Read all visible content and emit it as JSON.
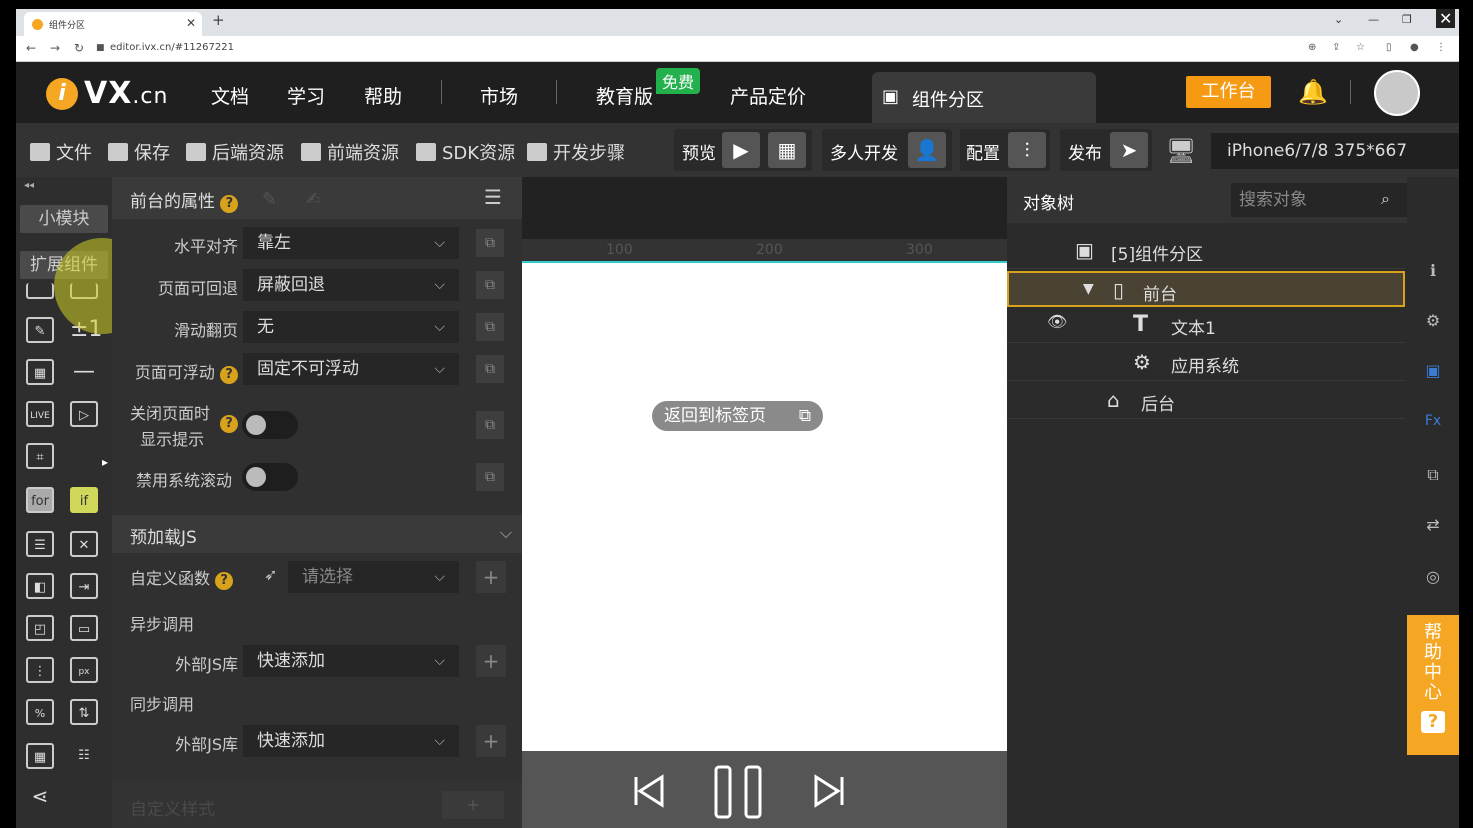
{
  "browser": {
    "tab_title": "组件分区",
    "url": "editor.ivx.cn/#11267221"
  },
  "header": {
    "logo_text": "VX",
    "logo_suffix": ".cn",
    "nav": [
      "文档",
      "学习",
      "帮助",
      "市场",
      "教育版",
      "产品定价"
    ],
    "free_badge": "免费",
    "active_tab": "组件分区",
    "workbench_label": "工作台"
  },
  "toolbar": {
    "items": [
      "文件",
      "保存",
      "后端资源",
      "前端资源",
      "SDK资源",
      "开发步骤"
    ],
    "preview": "预览",
    "multi_dev": "多人开发",
    "config": "配置",
    "publish": "发布",
    "device": "iPhone6/7/8 375*667"
  },
  "left_bar": {
    "small_module": "小模块",
    "extend": "扩展组件",
    "for_label": "for",
    "if_label": "if"
  },
  "props": {
    "header": "前台的属性",
    "rows": [
      {
        "label": "水平对齐",
        "value": "靠左"
      },
      {
        "label": "页面可回退",
        "value": "屏蔽回退"
      },
      {
        "label": "滑动翻页",
        "value": "无"
      },
      {
        "label": "页面可浮动",
        "value": "固定不可浮动"
      }
    ],
    "close_hint_line1": "关闭页面时",
    "close_hint_line2": "显示提示",
    "disable_scroll": "禁用系统滚动",
    "preload_header": "预加载JS",
    "custom_fn": "自定义函数",
    "custom_fn_placeholder": "请选择",
    "async_call": "异步调用",
    "ext_lib": "外部JS库",
    "quick_add": "快速添加",
    "sync_call": "同步调用",
    "custom_style": "自定义样式"
  },
  "canvas": {
    "ruler": [
      "100",
      "200",
      "300"
    ],
    "back_to_tab": "返回到标签页"
  },
  "tree": {
    "title": "对象树",
    "search_placeholder": "搜索对象",
    "nodes": [
      "[5]组件分区",
      "前台",
      "文本1",
      "应用系统",
      "后台"
    ]
  },
  "help": {
    "label": "帮助中心",
    "q": "?"
  }
}
